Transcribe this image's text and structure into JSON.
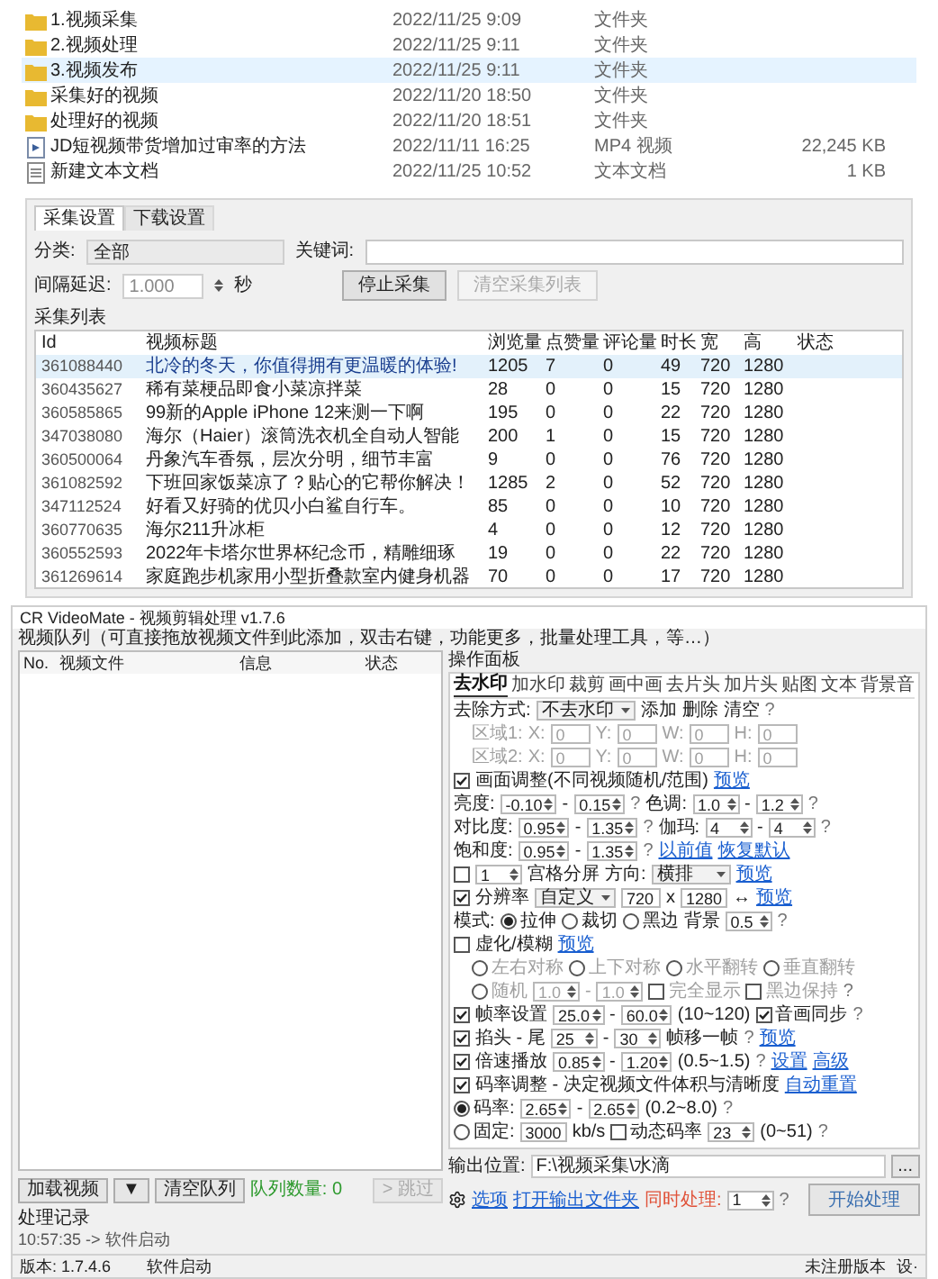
{
  "files": [
    {
      "name": "1.视频采集",
      "date": "2022/11/25 9:09",
      "type": "文件夹",
      "kind": "folder",
      "selected": false
    },
    {
      "name": "2.视频处理",
      "date": "2022/11/25 9:11",
      "type": "文件夹",
      "kind": "folder",
      "selected": false
    },
    {
      "name": "3.视频发布",
      "date": "2022/11/25 9:11",
      "type": "文件夹",
      "kind": "folder",
      "selected": true
    },
    {
      "name": "采集好的视频",
      "date": "2022/11/20 18:50",
      "type": "文件夹",
      "kind": "folder",
      "selected": false
    },
    {
      "name": "处理好的视频",
      "date": "2022/11/20 18:51",
      "type": "文件夹",
      "kind": "folder",
      "selected": false
    },
    {
      "name": "JD短视频带货增加过审率的方法",
      "date": "2022/11/11 16:25",
      "type": "MP4 视频",
      "size": "22,245 KB",
      "kind": "video",
      "selected": false
    },
    {
      "name": "新建文本文档",
      "date": "2022/11/25 10:52",
      "type": "文本文档",
      "size": "1 KB",
      "kind": "text",
      "selected": false
    }
  ],
  "collector": {
    "tabs": [
      {
        "label": "采集设置",
        "selected": true
      },
      {
        "label": "下载设置",
        "selected": false
      }
    ],
    "category_label": "分类:",
    "category_value": "全部",
    "keyword_label": "关键词:",
    "interval_label": "间隔延迟:",
    "interval_value": "1.000",
    "interval_unit": "秒",
    "buttons": [
      {
        "label": "停止采集",
        "disabled": false
      },
      {
        "label": "清空采集列表",
        "disabled": true
      }
    ],
    "list_title": "采集列表",
    "columns": [
      "Id",
      "视频标题",
      "浏览量",
      "点赞量",
      "评论量",
      "时长",
      "宽",
      "高",
      "状态"
    ],
    "rows": [
      {
        "selected": true,
        "cells": [
          "361088440",
          "北冷的冬天，你值得拥有更温暖的体验!",
          "1205",
          "7",
          "0",
          "49",
          "720",
          "1280"
        ]
      },
      {
        "selected": false,
        "cells": [
          "360435627",
          "稀有菜梗品即食小菜凉拌菜",
          "28",
          "0",
          "0",
          "15",
          "720",
          "1280"
        ]
      },
      {
        "selected": false,
        "cells": [
          "360585865",
          "99新的Apple iPhone 12来测一下啊",
          "195",
          "0",
          "0",
          "22",
          "720",
          "1280"
        ]
      },
      {
        "selected": false,
        "cells": [
          "347038080",
          "海尔（Haier）滚筒洗衣机全自动人智能",
          "200",
          "1",
          "0",
          "15",
          "720",
          "1280"
        ]
      },
      {
        "selected": false,
        "cells": [
          "360500064",
          "丹象汽车香氛，层次分明，细节丰富",
          "9",
          "0",
          "0",
          "76",
          "720",
          "1280"
        ]
      },
      {
        "selected": false,
        "cells": [
          "361082592",
          "下班回家饭菜凉了？贴心的它帮你解决！",
          "1285",
          "2",
          "0",
          "52",
          "720",
          "1280"
        ]
      },
      {
        "selected": false,
        "cells": [
          "347112524",
          "好看又好骑的优贝小白鲨自行车。",
          "85",
          "0",
          "0",
          "10",
          "720",
          "1280"
        ]
      },
      {
        "selected": false,
        "cells": [
          "360770635",
          "海尔211升冰柜",
          "4",
          "0",
          "0",
          "12",
          "720",
          "1280"
        ]
      },
      {
        "selected": false,
        "cells": [
          "360552593",
          "2022年卡塔尔世界杯纪念币，精雕细琢",
          "19",
          "0",
          "0",
          "22",
          "720",
          "1280"
        ]
      },
      {
        "selected": false,
        "cells": [
          "361269614",
          "家庭跑步机家用小型折叠款室内健身机器",
          "70",
          "0",
          "0",
          "17",
          "720",
          "1280"
        ]
      }
    ]
  },
  "app": {
    "title": "CR VideoMate - 视频剪辑处理 v1.7.6",
    "queue_hint": "视频队列（可直接拖放视频文件到此添加，双击右键，功能更多，批量处理工具，等…）",
    "queue_columns": [
      "No.",
      "视频文件",
      "信息",
      "状态"
    ],
    "queue_buttons": [
      {
        "label": "加载视频",
        "kind": "button",
        "disabled": false
      },
      {
        "label": "▼",
        "kind": "button",
        "disabled": false
      },
      {
        "label": "清空队列",
        "kind": "button",
        "disabled": false
      },
      {
        "label": "队列数量: 0",
        "kind": "count",
        "disabled": false
      },
      {
        "label": "> 跳过",
        "kind": "button",
        "disabled": true
      }
    ],
    "log_title": "处理记录",
    "log_lines": [
      "10:57:35 -> 软件启动"
    ],
    "panel_title": "操作面板",
    "panel_tabs": [
      {
        "label": "去水印",
        "selected": true
      },
      {
        "label": "加水印",
        "selected": false
      },
      {
        "label": "裁剪",
        "selected": false
      },
      {
        "label": "画中画",
        "selected": false
      },
      {
        "label": "去片头",
        "selected": false
      },
      {
        "label": "加片头",
        "selected": false
      },
      {
        "label": "贴图",
        "selected": false
      },
      {
        "label": "文本",
        "selected": false
      },
      {
        "label": "背景音",
        "selected": false
      }
    ],
    "settings": [
      {
        "disabled": false,
        "items": [
          {
            "kind": "label",
            "text": "去除方式:"
          },
          {
            "kind": "select",
            "text": "不去水印"
          },
          {
            "kind": "label",
            "text": "添加"
          },
          {
            "kind": "label",
            "text": "删除"
          },
          {
            "kind": "label",
            "text": "清空"
          },
          {
            "kind": "help",
            "text": "?"
          }
        ]
      },
      {
        "disabled": true,
        "items": [
          {
            "kind": "label",
            "text": "区域1:"
          },
          {
            "kind": "label",
            "text": "X:"
          },
          {
            "kind": "field",
            "text": "0"
          },
          {
            "kind": "label",
            "text": "Y:"
          },
          {
            "kind": "field",
            "text": "0"
          },
          {
            "kind": "label",
            "text": "W:"
          },
          {
            "kind": "field",
            "text": "0"
          },
          {
            "kind": "label",
            "text": "H:"
          },
          {
            "kind": "field",
            "text": "0"
          }
        ]
      },
      {
        "disabled": true,
        "items": [
          {
            "kind": "label",
            "text": "区域2:"
          },
          {
            "kind": "label",
            "text": "X:"
          },
          {
            "kind": "field",
            "text": "0"
          },
          {
            "kind": "label",
            "text": "Y:"
          },
          {
            "kind": "field",
            "text": "0"
          },
          {
            "kind": "label",
            "text": "W:"
          },
          {
            "kind": "field",
            "text": "0"
          },
          {
            "kind": "label",
            "text": "H:"
          },
          {
            "kind": "field",
            "text": "0"
          }
        ]
      },
      {
        "disabled": false,
        "checked": true,
        "items": [
          {
            "kind": "label",
            "text": "画面调整(不同视频随机/范围)"
          },
          {
            "kind": "link",
            "text": "预览"
          }
        ]
      },
      {
        "disabled": false,
        "items": [
          {
            "kind": "label",
            "text": "亮度:"
          },
          {
            "kind": "spin",
            "text": "-0.10"
          },
          {
            "kind": "label",
            "text": "-"
          },
          {
            "kind": "spin",
            "text": "0.15"
          },
          {
            "kind": "help",
            "text": "?"
          },
          {
            "kind": "label",
            "text": "色调:"
          },
          {
            "kind": "spin",
            "text": "1.0"
          },
          {
            "kind": "label",
            "text": "-"
          },
          {
            "kind": "spin",
            "text": "1.2"
          },
          {
            "kind": "help",
            "text": "?"
          }
        ]
      },
      {
        "disabled": false,
        "items": [
          {
            "kind": "label",
            "text": "对比度:"
          },
          {
            "kind": "spin",
            "text": "0.95"
          },
          {
            "kind": "label",
            "text": "-"
          },
          {
            "kind": "spin",
            "text": "1.35"
          },
          {
            "kind": "help",
            "text": "?"
          },
          {
            "kind": "label",
            "text": "伽玛:"
          },
          {
            "kind": "spin",
            "text": "4"
          },
          {
            "kind": "label",
            "text": "-"
          },
          {
            "kind": "spin",
            "text": "4"
          },
          {
            "kind": "help",
            "text": "?"
          }
        ]
      },
      {
        "disabled": false,
        "items": [
          {
            "kind": "label",
            "text": "饱和度:"
          },
          {
            "kind": "spin",
            "text": "0.95"
          },
          {
            "kind": "label",
            "text": "-"
          },
          {
            "kind": "spin",
            "text": "1.35"
          },
          {
            "kind": "help",
            "text": "?"
          },
          {
            "kind": "link",
            "text": "以前值"
          },
          {
            "kind": "link",
            "text": "恢复默认"
          }
        ]
      },
      {
        "disabled": false,
        "checked": false,
        "items": [
          {
            "kind": "spin",
            "text": "1"
          },
          {
            "kind": "label",
            "text": "宫格分屏"
          },
          {
            "kind": "label",
            "text": "方向:"
          },
          {
            "kind": "select",
            "text": "横排"
          },
          {
            "kind": "link",
            "text": "预览"
          }
        ]
      },
      {
        "disabled": false,
        "checked": true,
        "items": [
          {
            "kind": "label",
            "text": "分辨率"
          },
          {
            "kind": "select",
            "text": "自定义"
          },
          {
            "kind": "field",
            "text": "720"
          },
          {
            "kind": "label",
            "text": "x"
          },
          {
            "kind": "field",
            "text": "1280"
          },
          {
            "kind": "label",
            "text": "↔"
          },
          {
            "kind": "link",
            "text": "预览"
          }
        ]
      },
      {
        "disabled": false,
        "items": [
          {
            "kind": "label",
            "text": "模式:"
          },
          {
            "kind": "radio",
            "text": "拉伸",
            "selected": true
          },
          {
            "kind": "radio",
            "text": "裁切",
            "selected": false
          },
          {
            "kind": "radio",
            "text": "黑边",
            "selected": false
          },
          {
            "kind": "label",
            "text": "背景"
          },
          {
            "kind": "spin",
            "text": "0.5"
          },
          {
            "kind": "help",
            "text": "?"
          }
        ]
      },
      {
        "disabled": false,
        "checked": false,
        "items": [
          {
            "kind": "label",
            "text": "虚化/模糊"
          },
          {
            "kind": "link",
            "text": "预览"
          }
        ]
      },
      {
        "disabled": true,
        "items": [
          {
            "kind": "radio",
            "text": "左右对称",
            "selected": false
          },
          {
            "kind": "radio",
            "text": "上下对称",
            "selected": false
          },
          {
            "kind": "radio",
            "text": "水平翻转",
            "selected": false
          },
          {
            "kind": "radio",
            "text": "垂直翻转",
            "selected": false
          }
        ]
      },
      {
        "disabled": true,
        "items": [
          {
            "kind": "radio",
            "text": "随机",
            "selected": false
          },
          {
            "kind": "spin",
            "text": "1.0"
          },
          {
            "kind": "label",
            "text": "-"
          },
          {
            "kind": "spin",
            "text": "1.0"
          },
          {
            "kind": "check",
            "text": "完全显示",
            "checked": false
          },
          {
            "kind": "check",
            "text": "黑边保持",
            "checked": false
          },
          {
            "kind": "help",
            "text": "?"
          }
        ]
      },
      {
        "disabled": false,
        "checked": true,
        "items": [
          {
            "kind": "label",
            "text": "帧率设置"
          },
          {
            "kind": "spin",
            "text": "25.0"
          },
          {
            "kind": "label",
            "text": "-"
          },
          {
            "kind": "spin",
            "text": "60.0"
          },
          {
            "kind": "label",
            "text": "(10~120)"
          },
          {
            "kind": "check",
            "text": "音画同步",
            "checked": true
          },
          {
            "kind": "help",
            "text": "?"
          }
        ]
      },
      {
        "disabled": false,
        "checked": true,
        "items": [
          {
            "kind": "label",
            "text": "掐头 - 尾"
          },
          {
            "kind": "spin",
            "text": "25"
          },
          {
            "kind": "label",
            "text": "-"
          },
          {
            "kind": "spin",
            "text": "30"
          },
          {
            "kind": "label",
            "text": "帧移一帧"
          },
          {
            "kind": "help",
            "text": "?"
          },
          {
            "kind": "link",
            "text": "预览"
          }
        ]
      },
      {
        "disabled": false,
        "checked": true,
        "items": [
          {
            "kind": "label",
            "text": "倍速播放"
          },
          {
            "kind": "spin",
            "text": "0.85"
          },
          {
            "kind": "label",
            "text": "-"
          },
          {
            "kind": "spin",
            "text": "1.20"
          },
          {
            "kind": "label",
            "text": "(0.5~1.5)"
          },
          {
            "kind": "help",
            "text": "?"
          },
          {
            "kind": "link",
            "text": "设置"
          },
          {
            "kind": "link",
            "text": "高级"
          }
        ]
      },
      {
        "disabled": false,
        "checked": true,
        "items": [
          {
            "kind": "label",
            "text": "码率调整 - 决定视频文件体积与清晰度"
          },
          {
            "kind": "link",
            "text": "自动重置"
          }
        ]
      },
      {
        "disabled": false,
        "items": [
          {
            "kind": "radio",
            "text": "码率:",
            "selected": true
          },
          {
            "kind": "spin",
            "text": "2.65"
          },
          {
            "kind": "label",
            "text": "-"
          },
          {
            "kind": "spin",
            "text": "2.65"
          },
          {
            "kind": "label",
            "text": "(0.2~8.0)"
          },
          {
            "kind": "help",
            "text": "?"
          }
        ]
      },
      {
        "disabled": false,
        "items": [
          {
            "kind": "radio",
            "text": "固定:",
            "selected": false
          },
          {
            "kind": "field",
            "text": "3000"
          },
          {
            "kind": "label",
            "text": "kb/s"
          },
          {
            "kind": "check",
            "text": "动态码率",
            "checked": false
          },
          {
            "kind": "spin",
            "text": "23"
          },
          {
            "kind": "label",
            "text": "(0~51)"
          },
          {
            "kind": "help",
            "text": "?"
          }
        ]
      }
    ],
    "output_label": "输出位置:",
    "output_value": "F:\\视频采集\\水滴",
    "browse_label": "...",
    "footer": [
      {
        "kind": "link",
        "text": "选项"
      },
      {
        "kind": "link",
        "text": "打开输出文件夹"
      },
      {
        "kind": "warn",
        "text": "同时处理:"
      },
      {
        "kind": "spin",
        "text": "1"
      },
      {
        "kind": "help",
        "text": "?"
      }
    ],
    "start_label": "开始处理",
    "status": {
      "version": "版本: 1.7.4.6",
      "message": "软件启动",
      "license": "未注册版本",
      "menu": "设·"
    }
  }
}
